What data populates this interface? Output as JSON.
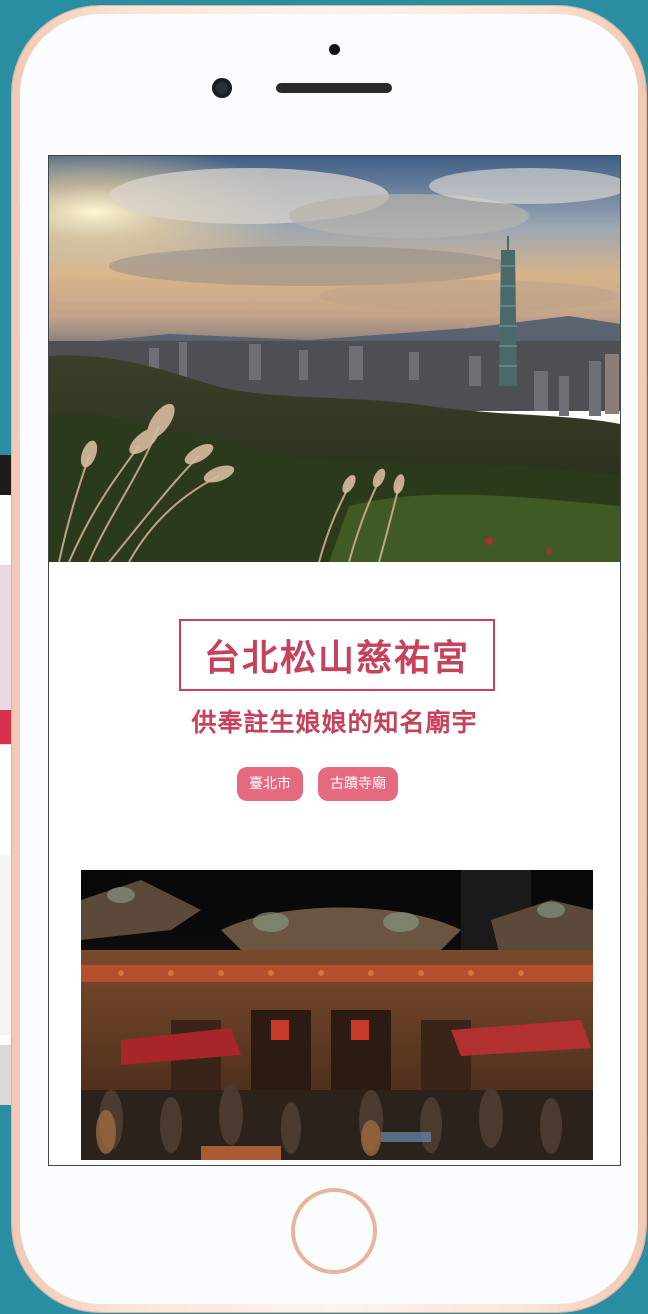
{
  "article": {
    "title": "台北松山慈祐宮",
    "subtitle": "供奉註生娘娘的知名廟宇",
    "tags": [
      "臺北市",
      "古蹟寺廟"
    ]
  },
  "colors": {
    "accent": "#c8415b",
    "tag_bg": "#e56a80",
    "backdrop": "#2a8ea3"
  },
  "images": {
    "hero": "taipei-skyline-with-taipei-101-at-sunset",
    "temple": "songshan-ciyou-temple-at-night"
  }
}
